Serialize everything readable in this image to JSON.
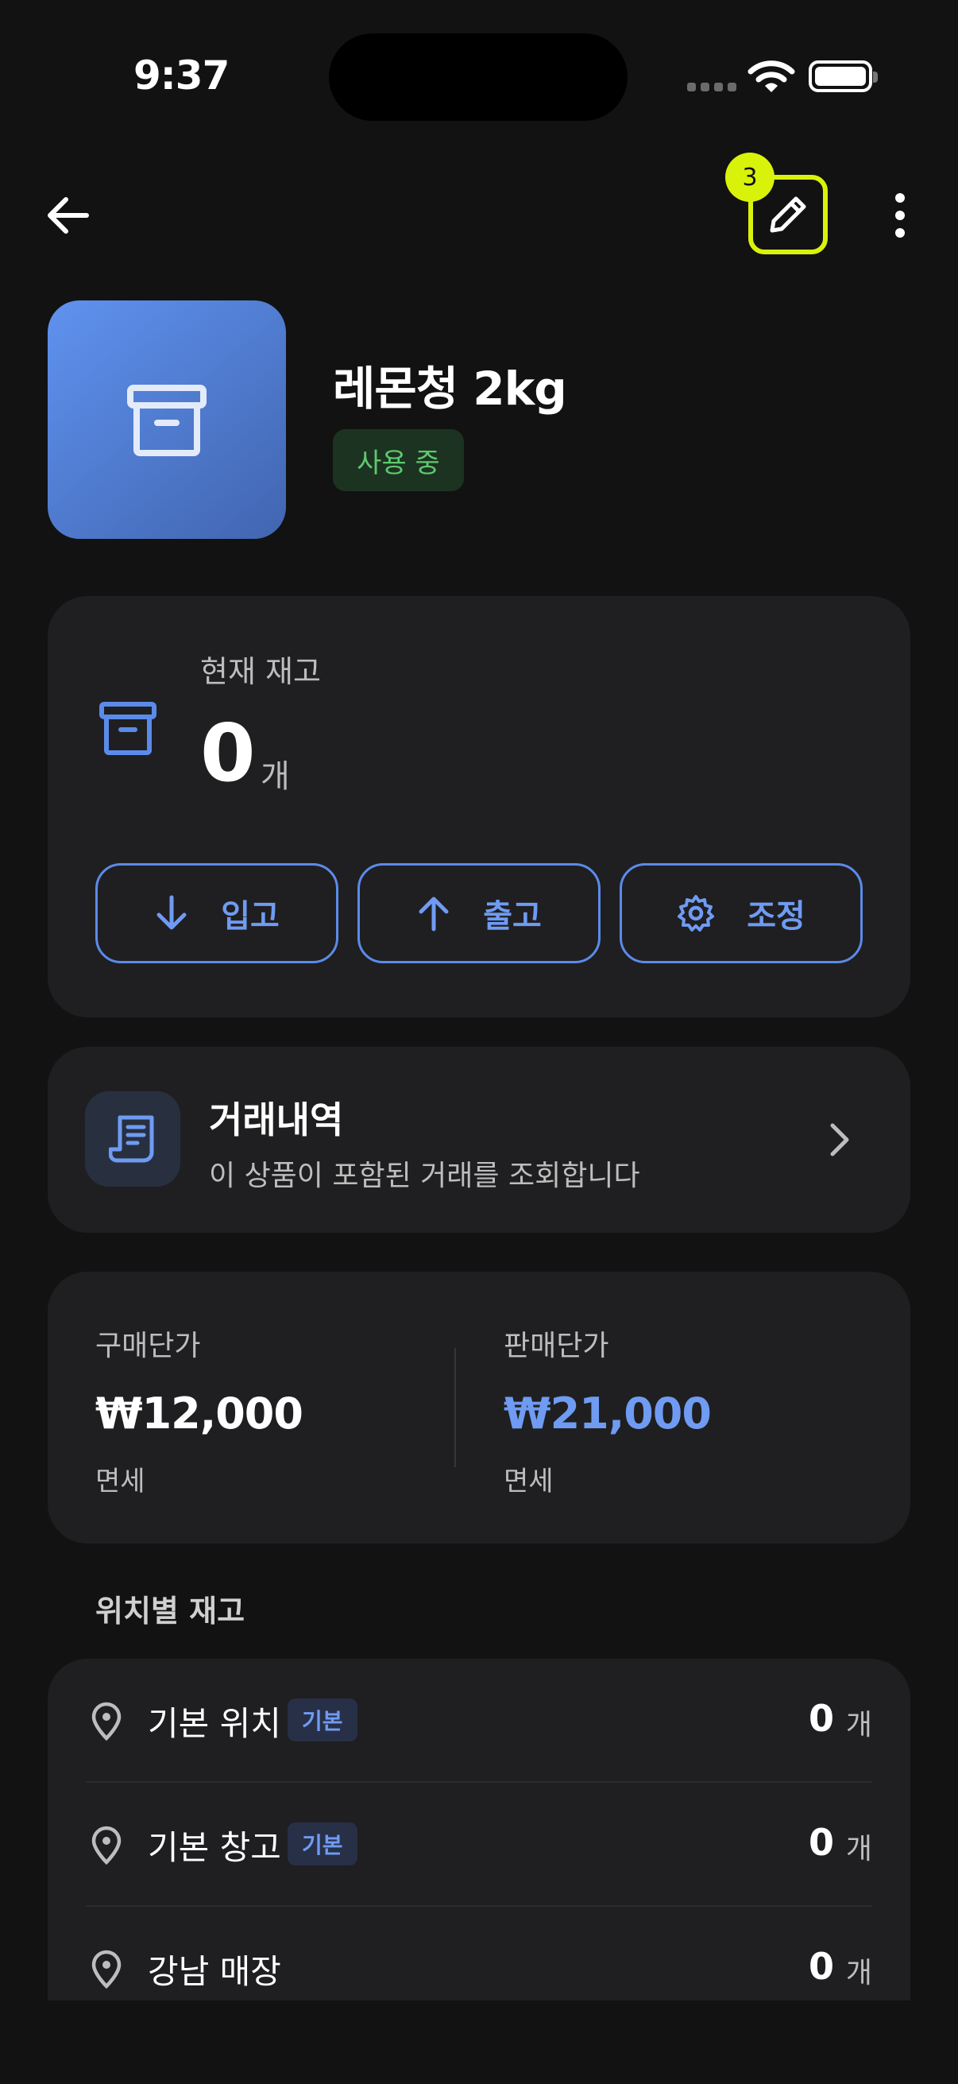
{
  "status_bar": {
    "time": "9:37"
  },
  "nav": {
    "edit_badge_count": "3"
  },
  "product": {
    "name": "레몬청 2kg",
    "status": "사용 중"
  },
  "stock": {
    "label": "현재 재고",
    "value": "0",
    "unit": "개",
    "actions": [
      {
        "label": "입고",
        "icon": "arrow-down-icon"
      },
      {
        "label": "출고",
        "icon": "arrow-up-icon"
      },
      {
        "label": "조정",
        "icon": "gear-icon"
      }
    ]
  },
  "transactions": {
    "title": "거래내역",
    "subtitle": "이 상품이 포함된 거래를 조회합니다"
  },
  "prices": {
    "purchase": {
      "label": "구매단가",
      "value": "₩12,000",
      "note": "면세"
    },
    "sale": {
      "label": "판매단가",
      "value": "₩21,000",
      "note": "면세"
    }
  },
  "locations": {
    "title": "위치별 재고",
    "items": [
      {
        "name": "기본 위치",
        "tag": "기본",
        "qty": "0",
        "unit": "개"
      },
      {
        "name": "기본 창고",
        "tag": "기본",
        "qty": "0",
        "unit": "개"
      },
      {
        "name": "강남 매장",
        "tag": "",
        "qty": "0",
        "unit": "개"
      }
    ]
  },
  "colors": {
    "background": "#121212",
    "card": "#1f1f21",
    "accent": "#5b8bea",
    "highlight": "#d9f20a",
    "active_green": "#5ec96e"
  }
}
